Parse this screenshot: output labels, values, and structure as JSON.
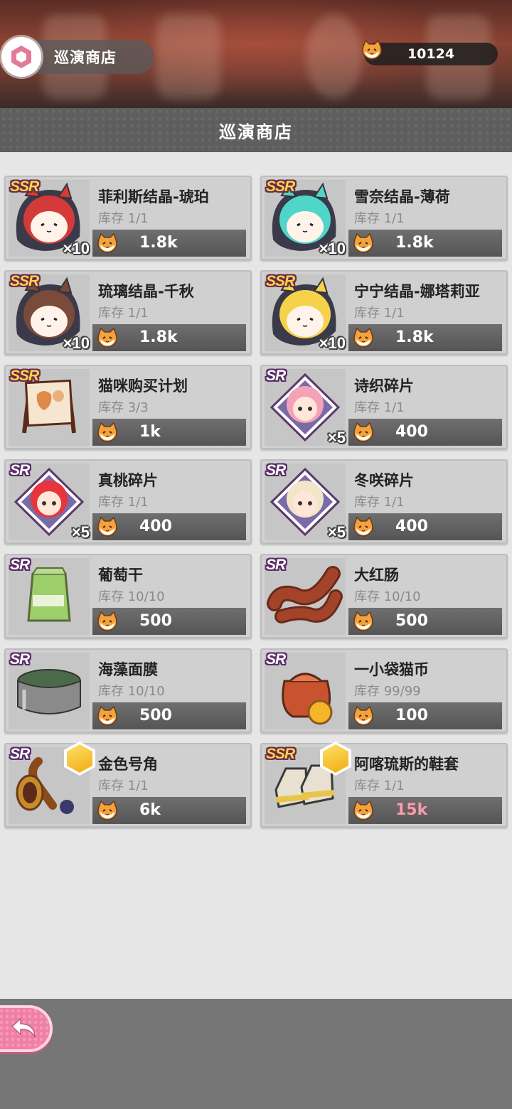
{
  "header": {
    "shop_tag_title": "巡演商店",
    "currency_amount": "10124"
  },
  "title_bar": {
    "title": "巡演商店"
  },
  "stock_prefix": "库存",
  "items": [
    {
      "rarity": "SSR",
      "name": "菲利斯结晶-琥珀",
      "stock": "1/1",
      "price": "1.8k",
      "qty": "×10",
      "icon": "cat-girl-crystal-amber-icon",
      "accent": "#d43a3a",
      "gem": false
    },
    {
      "rarity": "SSR",
      "name": "雪奈结晶-薄荷",
      "stock": "1/1",
      "price": "1.8k",
      "qty": "×10",
      "icon": "cat-girl-crystal-mint-icon",
      "accent": "#4fd6c8",
      "gem": false
    },
    {
      "rarity": "SSR",
      "name": "琉璃结晶-千秋",
      "stock": "1/1",
      "price": "1.8k",
      "qty": "×10",
      "icon": "cat-girl-crystal-chiaki-icon",
      "accent": "#7a4a3a",
      "gem": false
    },
    {
      "rarity": "SSR",
      "name": "宁宁结晶-娜塔莉亚",
      "stock": "1/1",
      "price": "1.8k",
      "qty": "×10",
      "icon": "cat-girl-crystal-natalia-icon",
      "accent": "#f5d24a",
      "gem": false
    },
    {
      "rarity": "SSR",
      "name": "猫咪购买计划",
      "stock": "3/3",
      "price": "1k",
      "qty": "",
      "icon": "signboard-icon",
      "accent": "#e08a4a",
      "gem": false
    },
    {
      "rarity": "SR",
      "name": "诗织碎片",
      "stock": "1/1",
      "price": "400",
      "qty": "×5",
      "icon": "shiori-shard-icon",
      "accent": "#f4a3b6",
      "gem": false
    },
    {
      "rarity": "SR",
      "name": "真桃碎片",
      "stock": "1/1",
      "price": "400",
      "qty": "×5",
      "icon": "mamomo-shard-icon",
      "accent": "#e8353c",
      "gem": false
    },
    {
      "rarity": "SR",
      "name": "冬咲碎片",
      "stock": "1/1",
      "price": "400",
      "qty": "×5",
      "icon": "fuyusaki-shard-icon",
      "accent": "#f1e6c8",
      "gem": false
    },
    {
      "rarity": "SR",
      "name": "葡萄干",
      "stock": "10/10",
      "price": "500",
      "qty": "",
      "icon": "raisin-bag-icon",
      "accent": "#9ccf6a",
      "gem": false
    },
    {
      "rarity": "SR",
      "name": "大红肠",
      "stock": "10/10",
      "price": "500",
      "qty": "",
      "icon": "sausage-icon",
      "accent": "#a3432a",
      "gem": false
    },
    {
      "rarity": "SR",
      "name": "海藻面膜",
      "stock": "10/10",
      "price": "500",
      "qty": "",
      "icon": "face-mask-jar-icon",
      "accent": "#8a8a8a",
      "gem": false
    },
    {
      "rarity": "SR",
      "name": "一小袋猫币",
      "stock": "99/99",
      "price": "100",
      "qty": "",
      "icon": "coin-bag-icon",
      "accent": "#c9532e",
      "gem": false
    },
    {
      "rarity": "SR",
      "name": "金色号角",
      "stock": "1/1",
      "price": "6k",
      "qty": "",
      "icon": "golden-horn-icon",
      "accent": "#c98b2a",
      "gem": true
    },
    {
      "rarity": "SSR",
      "name": "阿喀琉斯的鞋套",
      "stock": "1/1",
      "price": "15k",
      "qty": "",
      "icon": "achilles-shoe-covers-icon",
      "accent": "#e7c44a",
      "gem": true,
      "price_highlight": true
    }
  ]
}
